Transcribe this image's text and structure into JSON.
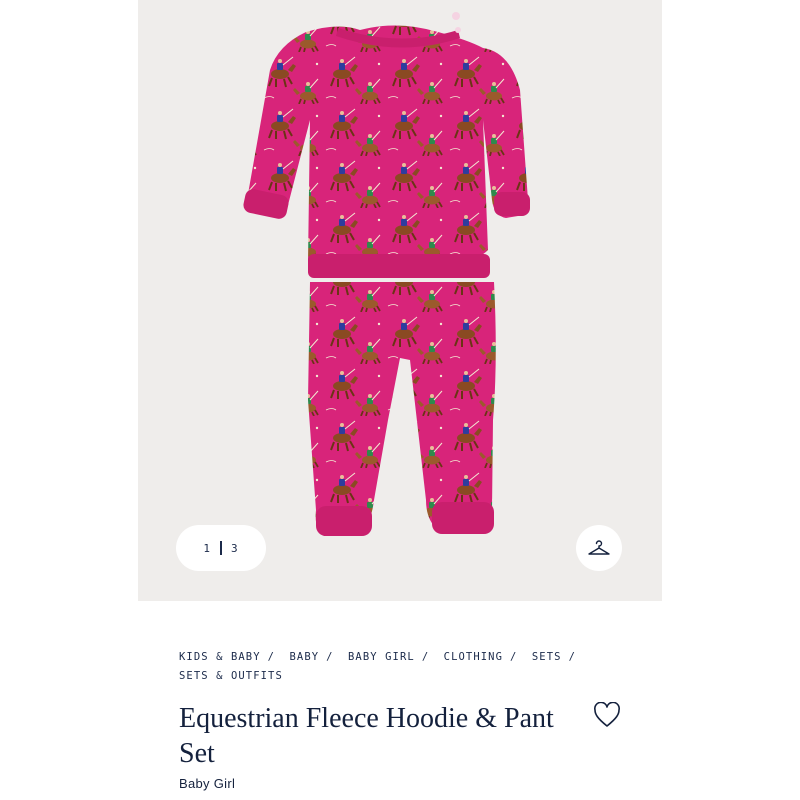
{
  "gallery": {
    "current_page": "1",
    "total_pages": "3",
    "hanger_icon": "hanger-icon",
    "garment_color": "#d8247a"
  },
  "breadcrumb": [
    "KIDS & BABY",
    "BABY",
    "BABY GIRL",
    "CLOTHING",
    "SETS",
    "SETS & OUTFITS"
  ],
  "product": {
    "title": "Equestrian Fleece Hoodie & Pant Set",
    "subtitle": "Baby Girl",
    "wishlist_icon": "heart-icon"
  },
  "colors": {
    "navy": "#14213d",
    "image_bg": "#efedeb"
  }
}
